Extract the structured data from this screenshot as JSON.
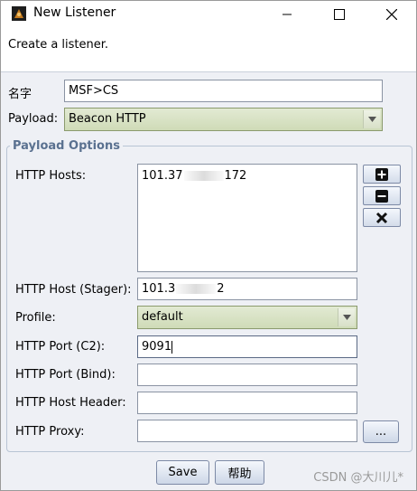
{
  "window": {
    "title": "New Listener"
  },
  "description": "Create a listener.",
  "form": {
    "name_label": "名字",
    "name_value": "MSF>CS",
    "payload_label": "Payload:",
    "payload_value": "Beacon HTTP"
  },
  "options": {
    "legend": "Payload Options",
    "http_hosts_label": "HTTP Hosts:",
    "http_hosts": [
      {
        "visible_prefix": "101.37",
        "visible_suffix": "172"
      }
    ],
    "stager_label": "HTTP Host (Stager):",
    "stager_prefix": "101.3",
    "stager_suffix": "2",
    "profile_label": "Profile:",
    "profile_value": "default",
    "port_c2_label": "HTTP Port (C2):",
    "port_c2_value": "9091",
    "port_bind_label": "HTTP Port (Bind):",
    "port_bind_value": "",
    "host_header_label": "HTTP Host Header:",
    "host_header_value": "",
    "proxy_label": "HTTP Proxy:",
    "proxy_value": "",
    "proxy_button_label": "..."
  },
  "buttons": {
    "save": "Save",
    "help": "帮助"
  },
  "watermark": "CSDN @大川儿*"
}
